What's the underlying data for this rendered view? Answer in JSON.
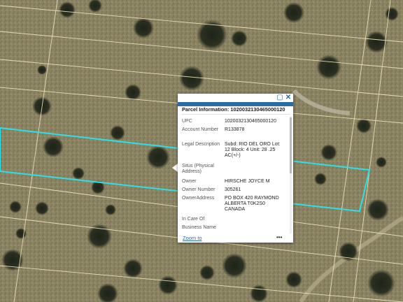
{
  "popup": {
    "title": "Parcel Information: 1020032130465000120",
    "controls": {
      "maximize_icon": "maximize-icon",
      "close_icon": "close-icon"
    },
    "fields": [
      {
        "key": "UPC",
        "value": "1020032130465000120"
      },
      {
        "key": "Account Number",
        "value": "R133878"
      },
      {
        "key": "Legal Description",
        "value": "Subd: RIO DEL ORO Lot: 12 Block: 4 Unit: 28 .25 AC(+/-)"
      },
      {
        "key": "Situs (Physical Address)",
        "value": ""
      },
      {
        "key": "Owner",
        "value": "HIRSCHE JOYCE M"
      },
      {
        "key": "Owner Number",
        "value": "305261"
      },
      {
        "key": "OwnerAddress",
        "value": "PO BOX 420 RAYMOND ALBERTA T0K2S0 CANADA"
      },
      {
        "key": "In Care Of",
        "value": ""
      },
      {
        "key": "Business Name",
        "value": ""
      }
    ],
    "zoom_label": "Zoom to",
    "more_label": "•••"
  },
  "colors": {
    "accent": "#2b6ca3",
    "highlight": "#2de0e8",
    "parcel_line": "#f2e8c0"
  }
}
